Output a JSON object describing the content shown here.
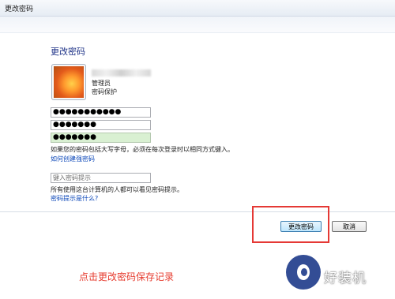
{
  "window": {
    "title": "更改密码"
  },
  "header": {
    "heading": "更改密码"
  },
  "account": {
    "role": "管理员",
    "status": "密码保护"
  },
  "form": {
    "current_password": "●●●●●●●●●●●",
    "new_password": "●●●●●●●",
    "confirm_password": "●●●●●●●",
    "caps_note": "如果您的密码包括大写字母，必须在每次登录时以相同方式键入。",
    "strong_link": "如何创建强密码",
    "hint_placeholder": "键入密码提示",
    "hint_note": "所有使用这台计算机的人都可以看见密码提示。",
    "hint_link": "密码提示是什么?"
  },
  "buttons": {
    "change_password": "更改密码",
    "cancel": "取消"
  },
  "annotation": {
    "caption": "点击更改密码保存记录"
  },
  "watermark": {
    "text": "好装机"
  },
  "colors": {
    "heading_blue": "#1e3287",
    "link_blue": "#0a46b8",
    "highlight_red": "#e53935",
    "caption_red": "#e63b2e",
    "confirm_field_green": "#d9f0d2"
  }
}
